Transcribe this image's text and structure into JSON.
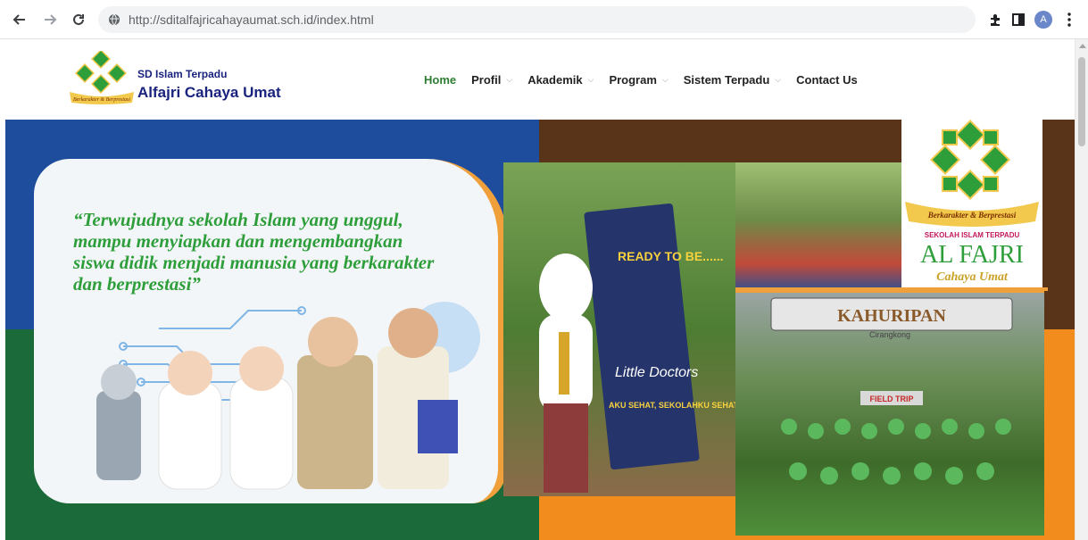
{
  "browser": {
    "url": "http://sditalfajricahayaumat.sch.id/index.html",
    "profile_initial": "A"
  },
  "site": {
    "brand_small": "SD Islam Terpadu",
    "brand_big": "Alfajri Cahaya Umat",
    "logo_ribbon": "Berkarakter & Berprestasi"
  },
  "nav": {
    "items": [
      {
        "label": "Home",
        "active": true,
        "dropdown": false
      },
      {
        "label": "Profil",
        "active": false,
        "dropdown": true
      },
      {
        "label": "Akademik",
        "active": false,
        "dropdown": true
      },
      {
        "label": "Program",
        "active": false,
        "dropdown": true
      },
      {
        "label": "Sistem Terpadu",
        "active": false,
        "dropdown": true
      },
      {
        "label": "Contact Us",
        "active": false,
        "dropdown": false
      }
    ]
  },
  "banner": {
    "quote": "“Terwujudnya sekolah Islam yang unggul, mampu menyiapkan dan mengembangkan siswa didik menjadi manusia yang berkarakter dan berprestasi”",
    "roll_banner_text_1": "READY TO BE......",
    "roll_banner_text_2": "Little Doctors",
    "roll_banner_text_3": "AKU SEHAT, SEKOLAHKU SEHAT",
    "gate_text": "KAHURIPAN",
    "gate_subtext": "Cirangkong",
    "field_trip_text": "FIELD TRIP",
    "logo_ribbon": "Berkarakter & Berprestasi",
    "logo_line1": "SEKOLAH ISLAM TERPADU",
    "logo_line2": "AL FAJRI",
    "logo_line3": "Cahaya Umat"
  },
  "colors": {
    "accent_green": "#2e7d32",
    "brand_blue": "#1a237e",
    "orange": "#f0a03a",
    "quote_green": "#2e9e3b"
  }
}
